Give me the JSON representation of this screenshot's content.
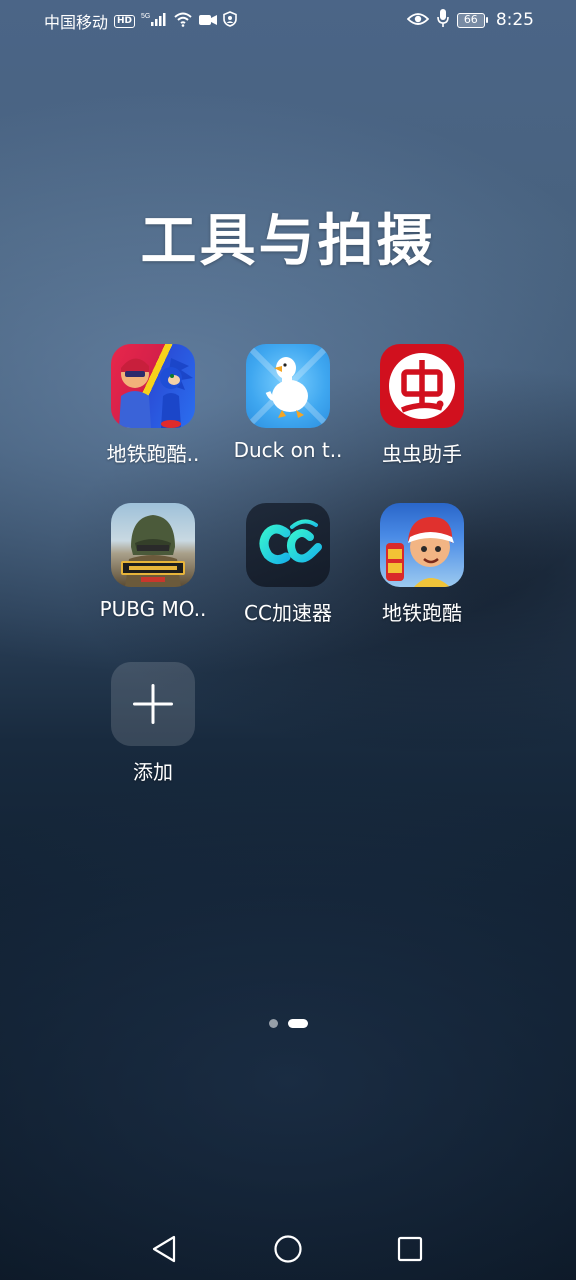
{
  "status_bar": {
    "carrier": "中国移动",
    "hd": "HD",
    "network": "5G",
    "battery": "66",
    "time": "8:25"
  },
  "folder": {
    "title": "工具与拍摄"
  },
  "apps": [
    {
      "label": "地铁跑酷..",
      "icon": "subway-sonic-icon"
    },
    {
      "label": "Duck on t..",
      "icon": "duck-icon"
    },
    {
      "label": "虫虫助手",
      "icon": "chongchong-icon"
    },
    {
      "label": "PUBG MO..",
      "icon": "pubg-icon"
    },
    {
      "label": "CC加速器",
      "icon": "cc-accelerator-icon"
    },
    {
      "label": "地铁跑酷",
      "icon": "subway-surfers-icon"
    }
  ],
  "add": {
    "label": "添加"
  },
  "pager": {
    "pages": 2,
    "active": 2
  }
}
